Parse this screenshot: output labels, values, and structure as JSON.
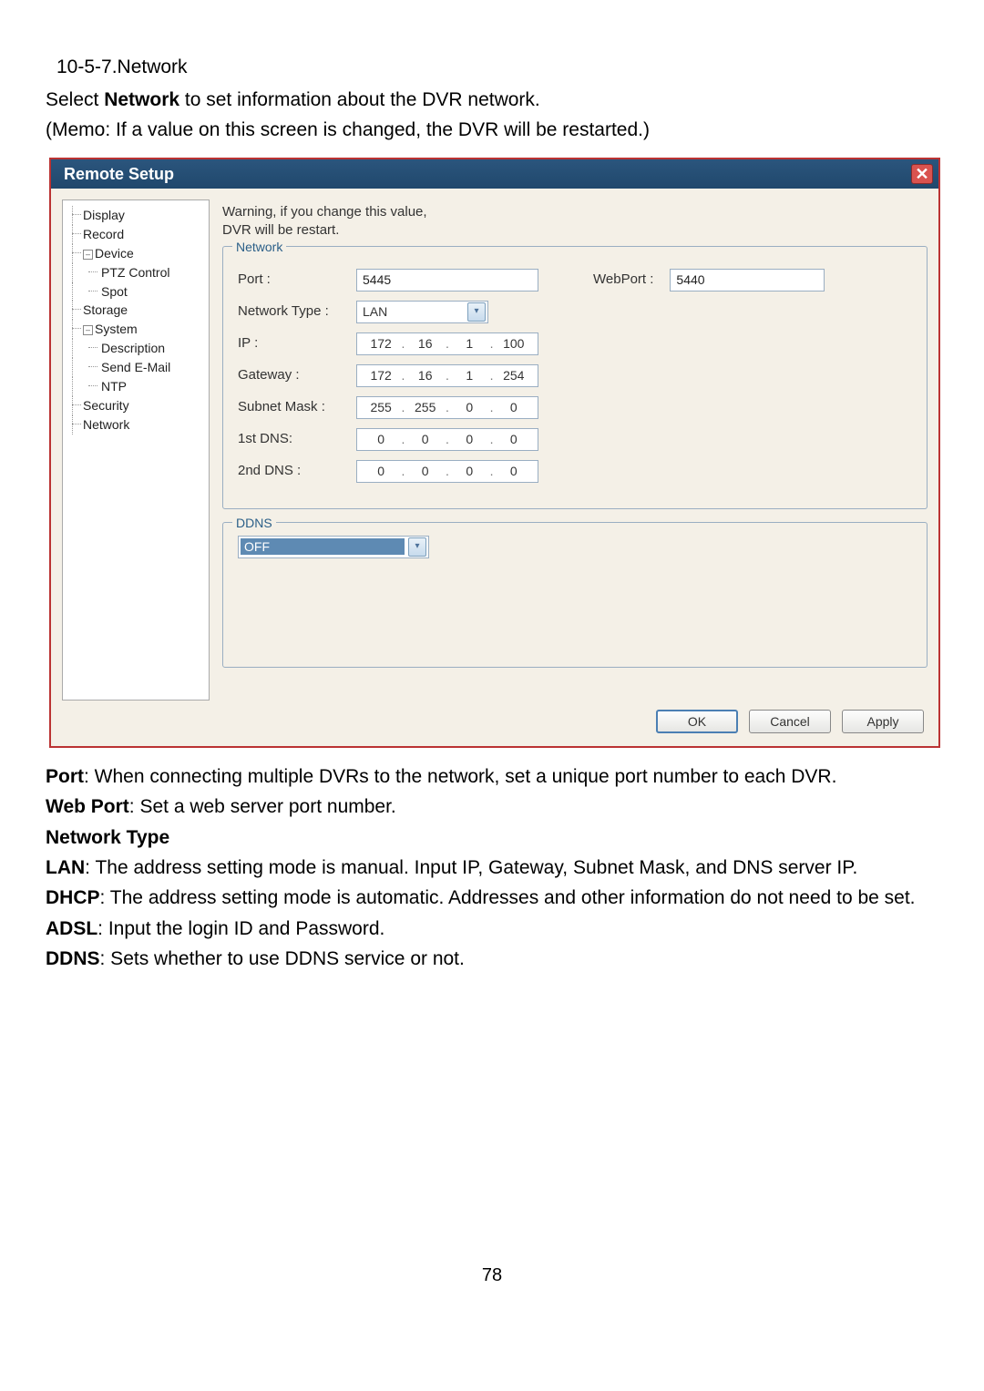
{
  "doc": {
    "section_no": "10-5-7.Network",
    "intro_pre": "Select ",
    "intro_bold": "Network",
    "intro_post": " to set information about the DVR network.",
    "memo": "(Memo: If a value on this screen is changed, the DVR will be restarted.)",
    "page_number": "78"
  },
  "dialog": {
    "title": "Remote Setup",
    "warning_l1": "Warning, if you change this value,",
    "warning_l2": "DVR will be restart.",
    "section_network": "Network",
    "section_ddns": "DDNS",
    "labels": {
      "port": "Port :",
      "webport": "WebPort :",
      "net_type": "Network Type :",
      "ip": "IP :",
      "gateway": "Gateway :",
      "subnet": "Subnet Mask :",
      "dns1": "1st DNS:",
      "dns2": "2nd DNS :"
    },
    "values": {
      "port": "5445",
      "webport": "5440",
      "net_type": "LAN",
      "ip": [
        "172",
        "16",
        "1",
        "100"
      ],
      "gateway": [
        "172",
        "16",
        "1",
        "254"
      ],
      "subnet": [
        "255",
        "255",
        "0",
        "0"
      ],
      "dns1": [
        "0",
        "0",
        "0",
        "0"
      ],
      "dns2": [
        "0",
        "0",
        "0",
        "0"
      ],
      "ddns": "OFF"
    },
    "buttons": {
      "ok": "OK",
      "cancel": "Cancel",
      "apply": "Apply"
    },
    "tree": {
      "display": "Display",
      "record": "Record",
      "device": "Device",
      "ptz": "PTZ Control",
      "spot": "Spot",
      "storage": "Storage",
      "system": "System",
      "description": "Description",
      "sendemail": "Send E-Mail",
      "ntp": "NTP",
      "security": "Security",
      "network": "Network"
    }
  },
  "defs": {
    "port_b": "Port",
    "port_t": ": When connecting multiple DVRs to the network, set a unique port number to each DVR.",
    "web_b": "Web Port",
    "web_t": ": Set a web server port number.",
    "ntype_b": "Network Type",
    "lan_b": "LAN",
    "lan_t": ": The address setting mode is manual. Input IP, Gateway, Subnet Mask, and DNS server IP.",
    "dhcp_b": "DHCP",
    "dhcp_t": ": The address setting mode is automatic. Addresses and other information do not need to be set.",
    "adsl_b": "ADSL",
    "adsl_t": ": Input the login ID and Password.",
    "ddns_b": "DDNS",
    "ddns_t": ": Sets whether to use DDNS service or not."
  }
}
